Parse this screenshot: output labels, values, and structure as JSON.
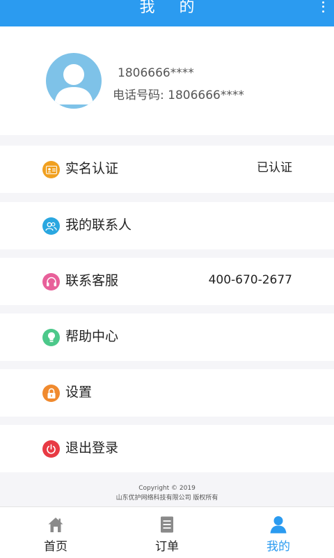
{
  "header": {
    "title": "我 的"
  },
  "profile": {
    "name": "1806666****",
    "phone_line": "电话号码: 1806666****"
  },
  "menu": [
    {
      "label": "实名认证",
      "value": "已认证",
      "icon": "id-card-icon",
      "color": "#f0a020"
    },
    {
      "label": "我的联系人",
      "value": "",
      "icon": "contacts-icon",
      "color": "#2aa7e0"
    },
    {
      "label": "联系客服",
      "value": "400-670-2677",
      "icon": "headset-icon",
      "color": "#e8609a"
    },
    {
      "label": "帮助中心",
      "value": "",
      "icon": "lightbulb-icon",
      "color": "#4cc88a"
    },
    {
      "label": "设置",
      "value": "",
      "icon": "lock-icon",
      "color": "#f08a2e"
    },
    {
      "label": "退出登录",
      "value": "",
      "icon": "power-icon",
      "color": "#e83a44"
    }
  ],
  "footer": {
    "copyright": "Copyright © 2019",
    "company": "山东优护网络科技有限公司 版权所有"
  },
  "tabs": [
    {
      "label": "首页",
      "icon": "home-icon",
      "active": false
    },
    {
      "label": "订单",
      "icon": "order-icon",
      "active": false
    },
    {
      "label": "我的",
      "icon": "user-icon",
      "active": true
    }
  ],
  "colors": {
    "accent": "#2b9bf0",
    "background": "#f5f5f8"
  }
}
